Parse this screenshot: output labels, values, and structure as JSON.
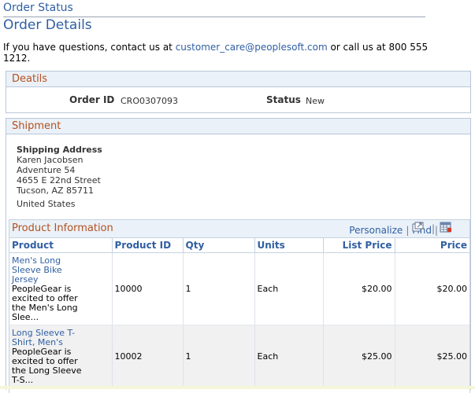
{
  "breadcrumb": "Order Status",
  "page_title": "Order Details",
  "contact": {
    "prefix": "If you have questions, contact us at ",
    "email": "customer_care@peoplesoft.com",
    "suffix_line1": " or call us at 800 555",
    "suffix_line2": "1212."
  },
  "details": {
    "header": "Deatils",
    "order_id_label": "Order ID",
    "order_id": "CRO0307093",
    "status_label": "Status",
    "status": "New"
  },
  "shipment": {
    "header": "Shipment",
    "address_label": "Shipping Address",
    "address": [
      "Karen Jacobsen",
      "Adventure 54",
      "4655 E 22nd Street",
      "Tucson, AZ 85711"
    ],
    "country": "United States"
  },
  "product_grid": {
    "title": "Product Information",
    "personalize": "Personalize",
    "find": "Find",
    "columns": [
      "Product",
      "Product ID",
      "Qty",
      "Units",
      "List Price",
      "Price"
    ],
    "rows": [
      {
        "name_lines": [
          "Men's Long",
          "Sleeve Bike",
          "Jersey"
        ],
        "desc_lines": [
          "PeopleGear is",
          "excited to offer",
          "the Men's Long",
          "Slee..."
        ],
        "product_id": "10000",
        "qty": "1",
        "units": "Each",
        "list_price": "$20.00",
        "price": "$20.00"
      },
      {
        "name_lines": [
          "Long Sleeve T-",
          "Shirt, Men's"
        ],
        "desc_lines": [
          "PeopleGear is",
          "excited to offer",
          "the Long Sleeve",
          "T-S..."
        ],
        "product_id": "10002",
        "qty": "1",
        "units": "Each",
        "list_price": "$25.00",
        "price": "$25.00"
      }
    ]
  }
}
